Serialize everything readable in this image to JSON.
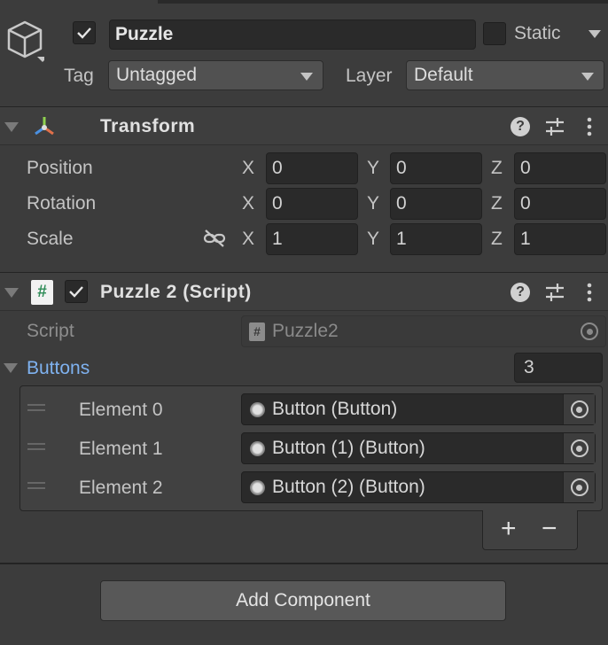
{
  "header": {
    "active_checked": true,
    "name": "Puzzle",
    "static_label": "Static",
    "tag_label": "Tag",
    "tag_value": "Untagged",
    "layer_label": "Layer",
    "layer_value": "Default"
  },
  "transform": {
    "title": "Transform",
    "rows": [
      {
        "label": "Position",
        "x": "0",
        "y": "0",
        "z": "0"
      },
      {
        "label": "Rotation",
        "x": "0",
        "y": "0",
        "z": "0"
      },
      {
        "label": "Scale",
        "x": "1",
        "y": "1",
        "z": "1"
      }
    ],
    "axis_x": "X",
    "axis_y": "Y",
    "axis_z": "Z"
  },
  "script_component": {
    "title": "Puzzle 2 (Script)",
    "enabled": true,
    "script_label": "Script",
    "script_value": "Puzzle2",
    "buttons_label": "Buttons",
    "buttons_count": "3",
    "elements": [
      {
        "label": "Element 0",
        "value": "Button (Button)"
      },
      {
        "label": "Element 1",
        "value": "Button (1) (Button)"
      },
      {
        "label": "Element 2",
        "value": "Button (2) (Button)"
      }
    ],
    "add_symbol": "+",
    "remove_symbol": "−"
  },
  "footer": {
    "add_component_label": "Add Component"
  },
  "icons": {
    "gameobject": "cube-icon",
    "transform": "transform-axes-icon",
    "script": "script-hash-icon",
    "help": "help-icon",
    "presets": "presets-sliders-icon",
    "menu": "kebab-menu-icon",
    "constrain": "constrain-proportions-icon",
    "picker": "object-picker-icon"
  },
  "colors": {
    "background": "#3c3c3c",
    "field": "#2a2a2a",
    "accent_link": "#7fb2f0"
  }
}
